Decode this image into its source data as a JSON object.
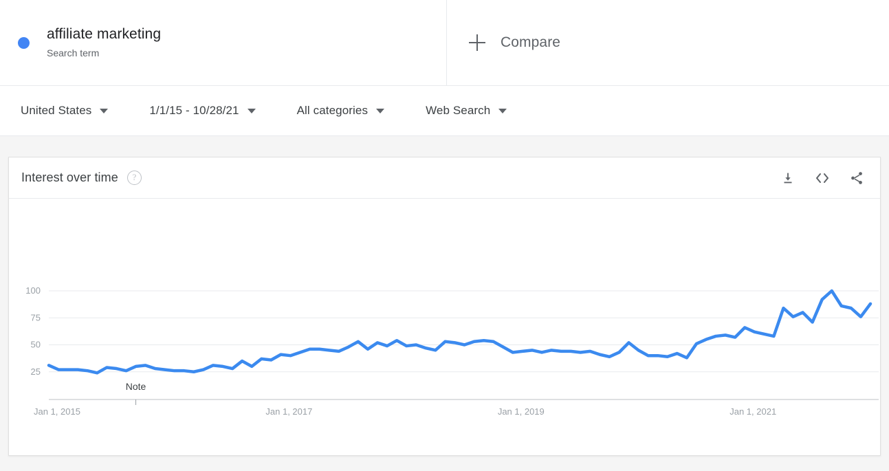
{
  "terms": {
    "items": [
      {
        "title": "affiliate marketing",
        "subtitle": "Search term",
        "color": "#4285F4"
      }
    ],
    "compare_label": "Compare",
    "plus_icon": "plus-icon"
  },
  "filters": [
    {
      "name": "location",
      "value": "United States"
    },
    {
      "name": "date-range",
      "value": "1/1/15 - 10/28/21"
    },
    {
      "name": "category",
      "value": "All categories"
    },
    {
      "name": "search-type",
      "value": "Web Search"
    }
  ],
  "card": {
    "title": "Interest over time",
    "help_icon": "help-icon",
    "actions": [
      {
        "name": "download-icon",
        "label": "Download"
      },
      {
        "name": "embed-icon",
        "label": "Embed"
      },
      {
        "name": "share-icon",
        "label": "Share"
      }
    ]
  },
  "chart_data": {
    "type": "line",
    "title": "Interest over time",
    "xlabel": "",
    "ylabel": "",
    "ylim": [
      0,
      100
    ],
    "yticks": [
      100,
      75,
      50,
      25
    ],
    "xticks": [
      "Jan 1, 2015",
      "Jan 1, 2017",
      "Jan 1, 2019",
      "Jan 1, 2021"
    ],
    "grid": true,
    "legend": false,
    "line_color": "#3b8aef",
    "annotations": [
      {
        "label": "Note",
        "x_index": 9
      }
    ],
    "x": [
      "Jan 2015",
      "Feb 2015",
      "Mar 2015",
      "Apr 2015",
      "May 2015",
      "Jun 2015",
      "Jul 2015",
      "Aug 2015",
      "Sep 2015",
      "Oct 2015",
      "Nov 2015",
      "Dec 2015",
      "Jan 2016",
      "Feb 2016",
      "Mar 2016",
      "Apr 2016",
      "May 2016",
      "Jun 2016",
      "Jul 2016",
      "Aug 2016",
      "Sep 2016",
      "Oct 2016",
      "Nov 2016",
      "Dec 2016",
      "Jan 2017",
      "Feb 2017",
      "Mar 2017",
      "Apr 2017",
      "May 2017",
      "Jun 2017",
      "Jul 2017",
      "Aug 2017",
      "Sep 2017",
      "Oct 2017",
      "Nov 2017",
      "Dec 2017",
      "Jan 2018",
      "Feb 2018",
      "Mar 2018",
      "Apr 2018",
      "May 2018",
      "Jun 2018",
      "Jul 2018",
      "Aug 2018",
      "Sep 2018",
      "Oct 2018",
      "Nov 2018",
      "Dec 2018",
      "Jan 2019",
      "Feb 2019",
      "Mar 2019",
      "Apr 2019",
      "May 2019",
      "Jun 2019",
      "Jul 2019",
      "Aug 2019",
      "Sep 2019",
      "Oct 2019",
      "Nov 2019",
      "Dec 2019",
      "Jan 2020",
      "Feb 2020",
      "Mar 2020",
      "Apr 2020",
      "May 2020",
      "Jun 2020",
      "Jul 2020",
      "Aug 2020",
      "Sep 2020",
      "Oct 2020",
      "Nov 2020",
      "Dec 2020",
      "Jan 2021",
      "Feb 2021",
      "Mar 2021",
      "Apr 2021",
      "May 2021",
      "Jun 2021",
      "Jul 2021",
      "Aug 2021",
      "Sep 2021",
      "Oct 2021"
    ],
    "values": [
      31,
      27,
      27,
      27,
      26,
      24,
      29,
      28,
      26,
      30,
      31,
      28,
      27,
      26,
      26,
      25,
      27,
      31,
      30,
      28,
      35,
      30,
      37,
      36,
      41,
      40,
      43,
      46,
      46,
      45,
      44,
      48,
      53,
      46,
      52,
      49,
      54,
      49,
      50,
      47,
      45,
      53,
      52,
      50,
      53,
      54,
      53,
      48,
      43,
      44,
      45,
      43,
      45,
      44,
      44,
      43,
      44,
      41,
      39,
      43,
      52,
      45,
      40,
      40,
      39,
      42,
      38,
      51,
      55,
      58,
      59,
      57,
      66,
      62,
      60,
      58,
      84,
      76,
      80,
      71,
      92,
      100,
      86,
      84,
      76,
      88
    ],
    "series": [
      {
        "name": "affiliate marketing",
        "color": "#3b8aef"
      }
    ]
  }
}
